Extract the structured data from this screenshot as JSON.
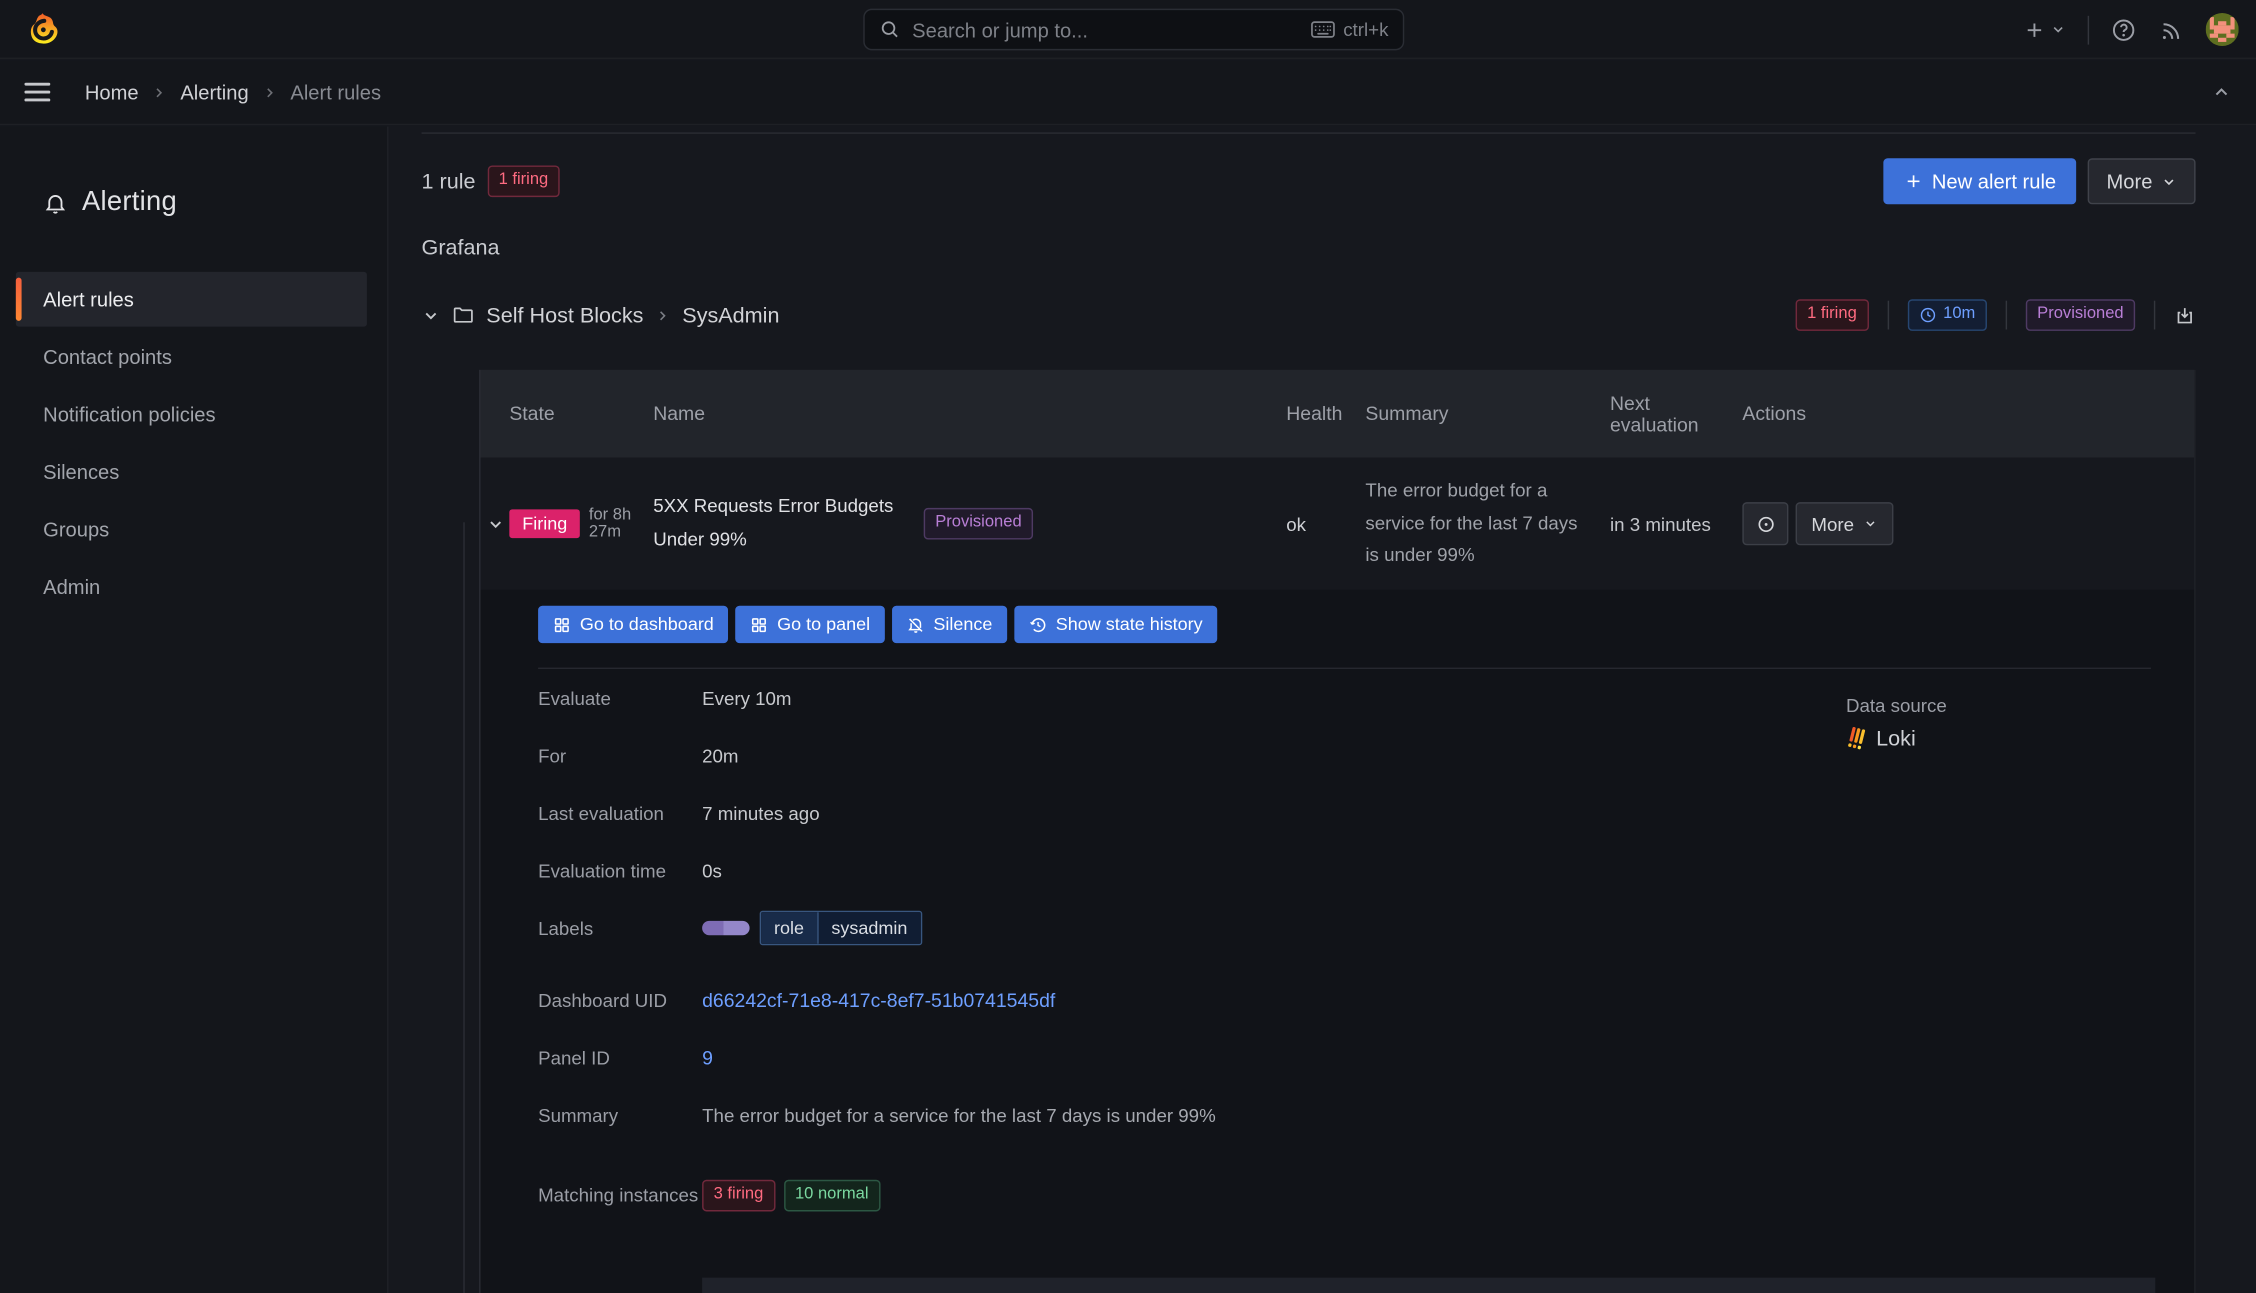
{
  "topbar": {
    "search_placeholder": "Search or jump to...",
    "shortcut": "ctrl+k"
  },
  "breadcrumb": {
    "items": [
      {
        "label": "Home"
      },
      {
        "label": "Alerting"
      },
      {
        "label": "Alert rules"
      }
    ]
  },
  "sidebar": {
    "title": "Alerting",
    "items": [
      {
        "label": "Alert rules",
        "active": true
      },
      {
        "label": "Contact points",
        "active": false
      },
      {
        "label": "Notification policies",
        "active": false
      },
      {
        "label": "Silences",
        "active": false
      },
      {
        "label": "Groups",
        "active": false
      },
      {
        "label": "Admin",
        "active": false
      }
    ]
  },
  "toolbar": {
    "rule_count": "1 rule",
    "firing_badge": "1 firing",
    "new_rule_label": "New alert rule",
    "more_label": "More"
  },
  "section": {
    "title": "Grafana"
  },
  "group": {
    "folder": "Self Host Blocks",
    "name": "SysAdmin",
    "firing_badge": "1 firing",
    "interval_badge": "10m",
    "provisioned_badge": "Provisioned"
  },
  "table": {
    "headers": {
      "state": "State",
      "name": "Name",
      "health": "Health",
      "summary": "Summary",
      "next_evaluation": "Next evaluation",
      "actions": "Actions"
    },
    "row": {
      "state": "Firing",
      "duration": "for 8h 27m",
      "name": "5XX Requests Error Budgets Under 99%",
      "provisioned_badge": "Provisioned",
      "health": "ok",
      "summary": "The error budget for a service for the last 7 days is under 99%",
      "next_evaluation": "in 3 minutes",
      "more_label": "More"
    }
  },
  "row_actions": {
    "go_to_dashboard": "Go to dashboard",
    "go_to_panel": "Go to panel",
    "silence": "Silence",
    "show_state_history": "Show state history"
  },
  "details": {
    "evaluate": {
      "label": "Evaluate",
      "value": "Every 10m"
    },
    "for": {
      "label": "For",
      "value": "20m"
    },
    "last_evaluation": {
      "label": "Last evaluation",
      "value": "7 minutes ago"
    },
    "evaluation_time": {
      "label": "Evaluation time",
      "value": "0s"
    },
    "labels": {
      "label": "Labels",
      "key": "role",
      "value": "sysadmin"
    },
    "data_source": {
      "label": "Data source",
      "value": "Loki"
    },
    "dashboard_uid": {
      "label": "Dashboard UID",
      "value": "d66242cf-71e8-417c-8ef7-51b0741545df"
    },
    "panel_id": {
      "label": "Panel ID",
      "value": "9"
    },
    "summary": {
      "label": "Summary",
      "value": "The error budget for a service for the last 7 days is under 99%"
    },
    "matching_instances": {
      "label": "Matching instances",
      "firing_badge": "3 firing",
      "normal_badge": "10 normal"
    }
  },
  "colors": {
    "accent_blue": "#3D71D9",
    "firing_pink": "#DB226A",
    "link_blue": "#6E9FFF",
    "brand_orange": "#FF8833",
    "provisioned_purple": "#B877D9",
    "normal_green": "#7BD8A0"
  }
}
